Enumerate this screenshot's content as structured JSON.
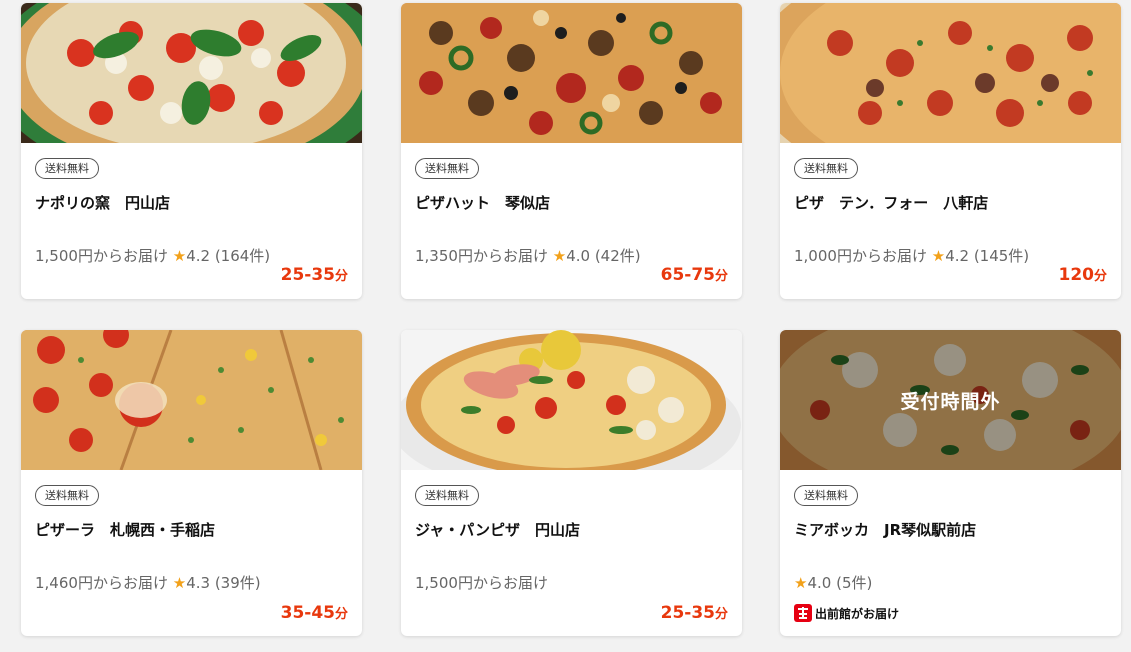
{
  "colors": {
    "accent_time": "#e8380d",
    "star": "#f2a11a"
  },
  "shops": [
    {
      "badge": "送料無料",
      "name": "ナポリの窯　円山店",
      "price": "1,500円からお届け",
      "star": "★",
      "rating": "4.2",
      "reviews": "(164件)",
      "time": "25-35",
      "unit": "分",
      "image_icon": "margherita-pizza-photo"
    },
    {
      "badge": "送料無料",
      "name": "ピザハット　琴似店",
      "price": "1,350円からお届け",
      "star": "★",
      "rating": "4.0",
      "reviews": "(42件)",
      "time": "65-75",
      "unit": "分",
      "image_icon": "supreme-pizza-photo"
    },
    {
      "badge": "送料無料",
      "name": "ピザ　テン．フォー　八軒店",
      "price": "1,000円からお届け",
      "star": "★",
      "rating": "4.2",
      "reviews": "(145件)",
      "time": "120",
      "unit": "分",
      "image_icon": "salami-pizza-photo"
    },
    {
      "badge": "送料無料",
      "name": "ピザーラ　札幌西・手稲店",
      "price": "1,460円からお届け",
      "star": "★",
      "rating": "4.3",
      "reviews": "(39件)",
      "time": "35-45",
      "unit": "分",
      "image_icon": "tomato-cheese-pizza-photo"
    },
    {
      "badge": "送料無料",
      "name": "ジャ・パンピザ　円山店",
      "price": "1,500円からお届け",
      "time": "25-35",
      "unit": "分",
      "image_icon": "seafood-pizza-photo"
    },
    {
      "badge": "送料無料",
      "name": "ミアボッカ　JR琴似駅前店",
      "star": "★",
      "rating": "4.0",
      "reviews": "(5件)",
      "closed_label": "受付時間外",
      "delivery_by": "出前館がお届け",
      "image_icon": "basil-pizza-photo"
    }
  ]
}
